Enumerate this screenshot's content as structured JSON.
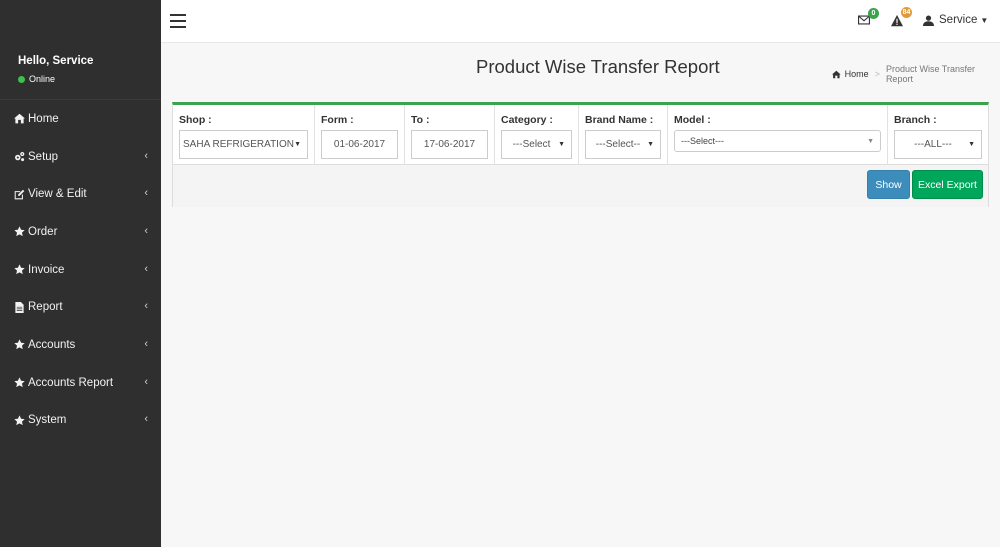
{
  "sidebar": {
    "greeting": "Hello, Service",
    "status": "Online",
    "items": [
      {
        "label": "Home",
        "icon": "home-icon"
      },
      {
        "label": "Setup",
        "icon": "cogs-icon"
      },
      {
        "label": "View & Edit",
        "icon": "edit-icon"
      },
      {
        "label": "Order",
        "icon": "star-icon"
      },
      {
        "label": "Invoice",
        "icon": "star-icon"
      },
      {
        "label": "Report",
        "icon": "file-icon"
      },
      {
        "label": "Accounts",
        "icon": "star-icon"
      },
      {
        "label": "Accounts Report",
        "icon": "star-icon"
      },
      {
        "label": "System",
        "icon": "star-icon"
      }
    ]
  },
  "topbar": {
    "mail_count": "0",
    "alert_count": "84",
    "user_name": "Service"
  },
  "page": {
    "title": "Product Wise Transfer Report",
    "breadcrumb_home": "Home",
    "breadcrumb_current": "Product Wise Transfer Report"
  },
  "form": {
    "shop_label": "Shop :",
    "shop_value": "SAHA REFRIGERATION",
    "from_label": "Form :",
    "from_value": "01-06-2017",
    "to_label": "To :",
    "to_value": "17-06-2017",
    "category_label": "Category :",
    "category_value": "---Select",
    "brand_label": "Brand Name :",
    "brand_value": "---Select--",
    "model_label": "Model :",
    "model_value": "---Select---",
    "branch_label": "Branch :",
    "branch_value": "---ALL---"
  },
  "buttons": {
    "show": "Show",
    "excel": "Excel Export"
  },
  "colors": {
    "sidebar_bg": "#2f2f2f",
    "accent_green": "#3aa34d",
    "show_button": "#3c8dbc",
    "excel_button": "#00a65a"
  }
}
